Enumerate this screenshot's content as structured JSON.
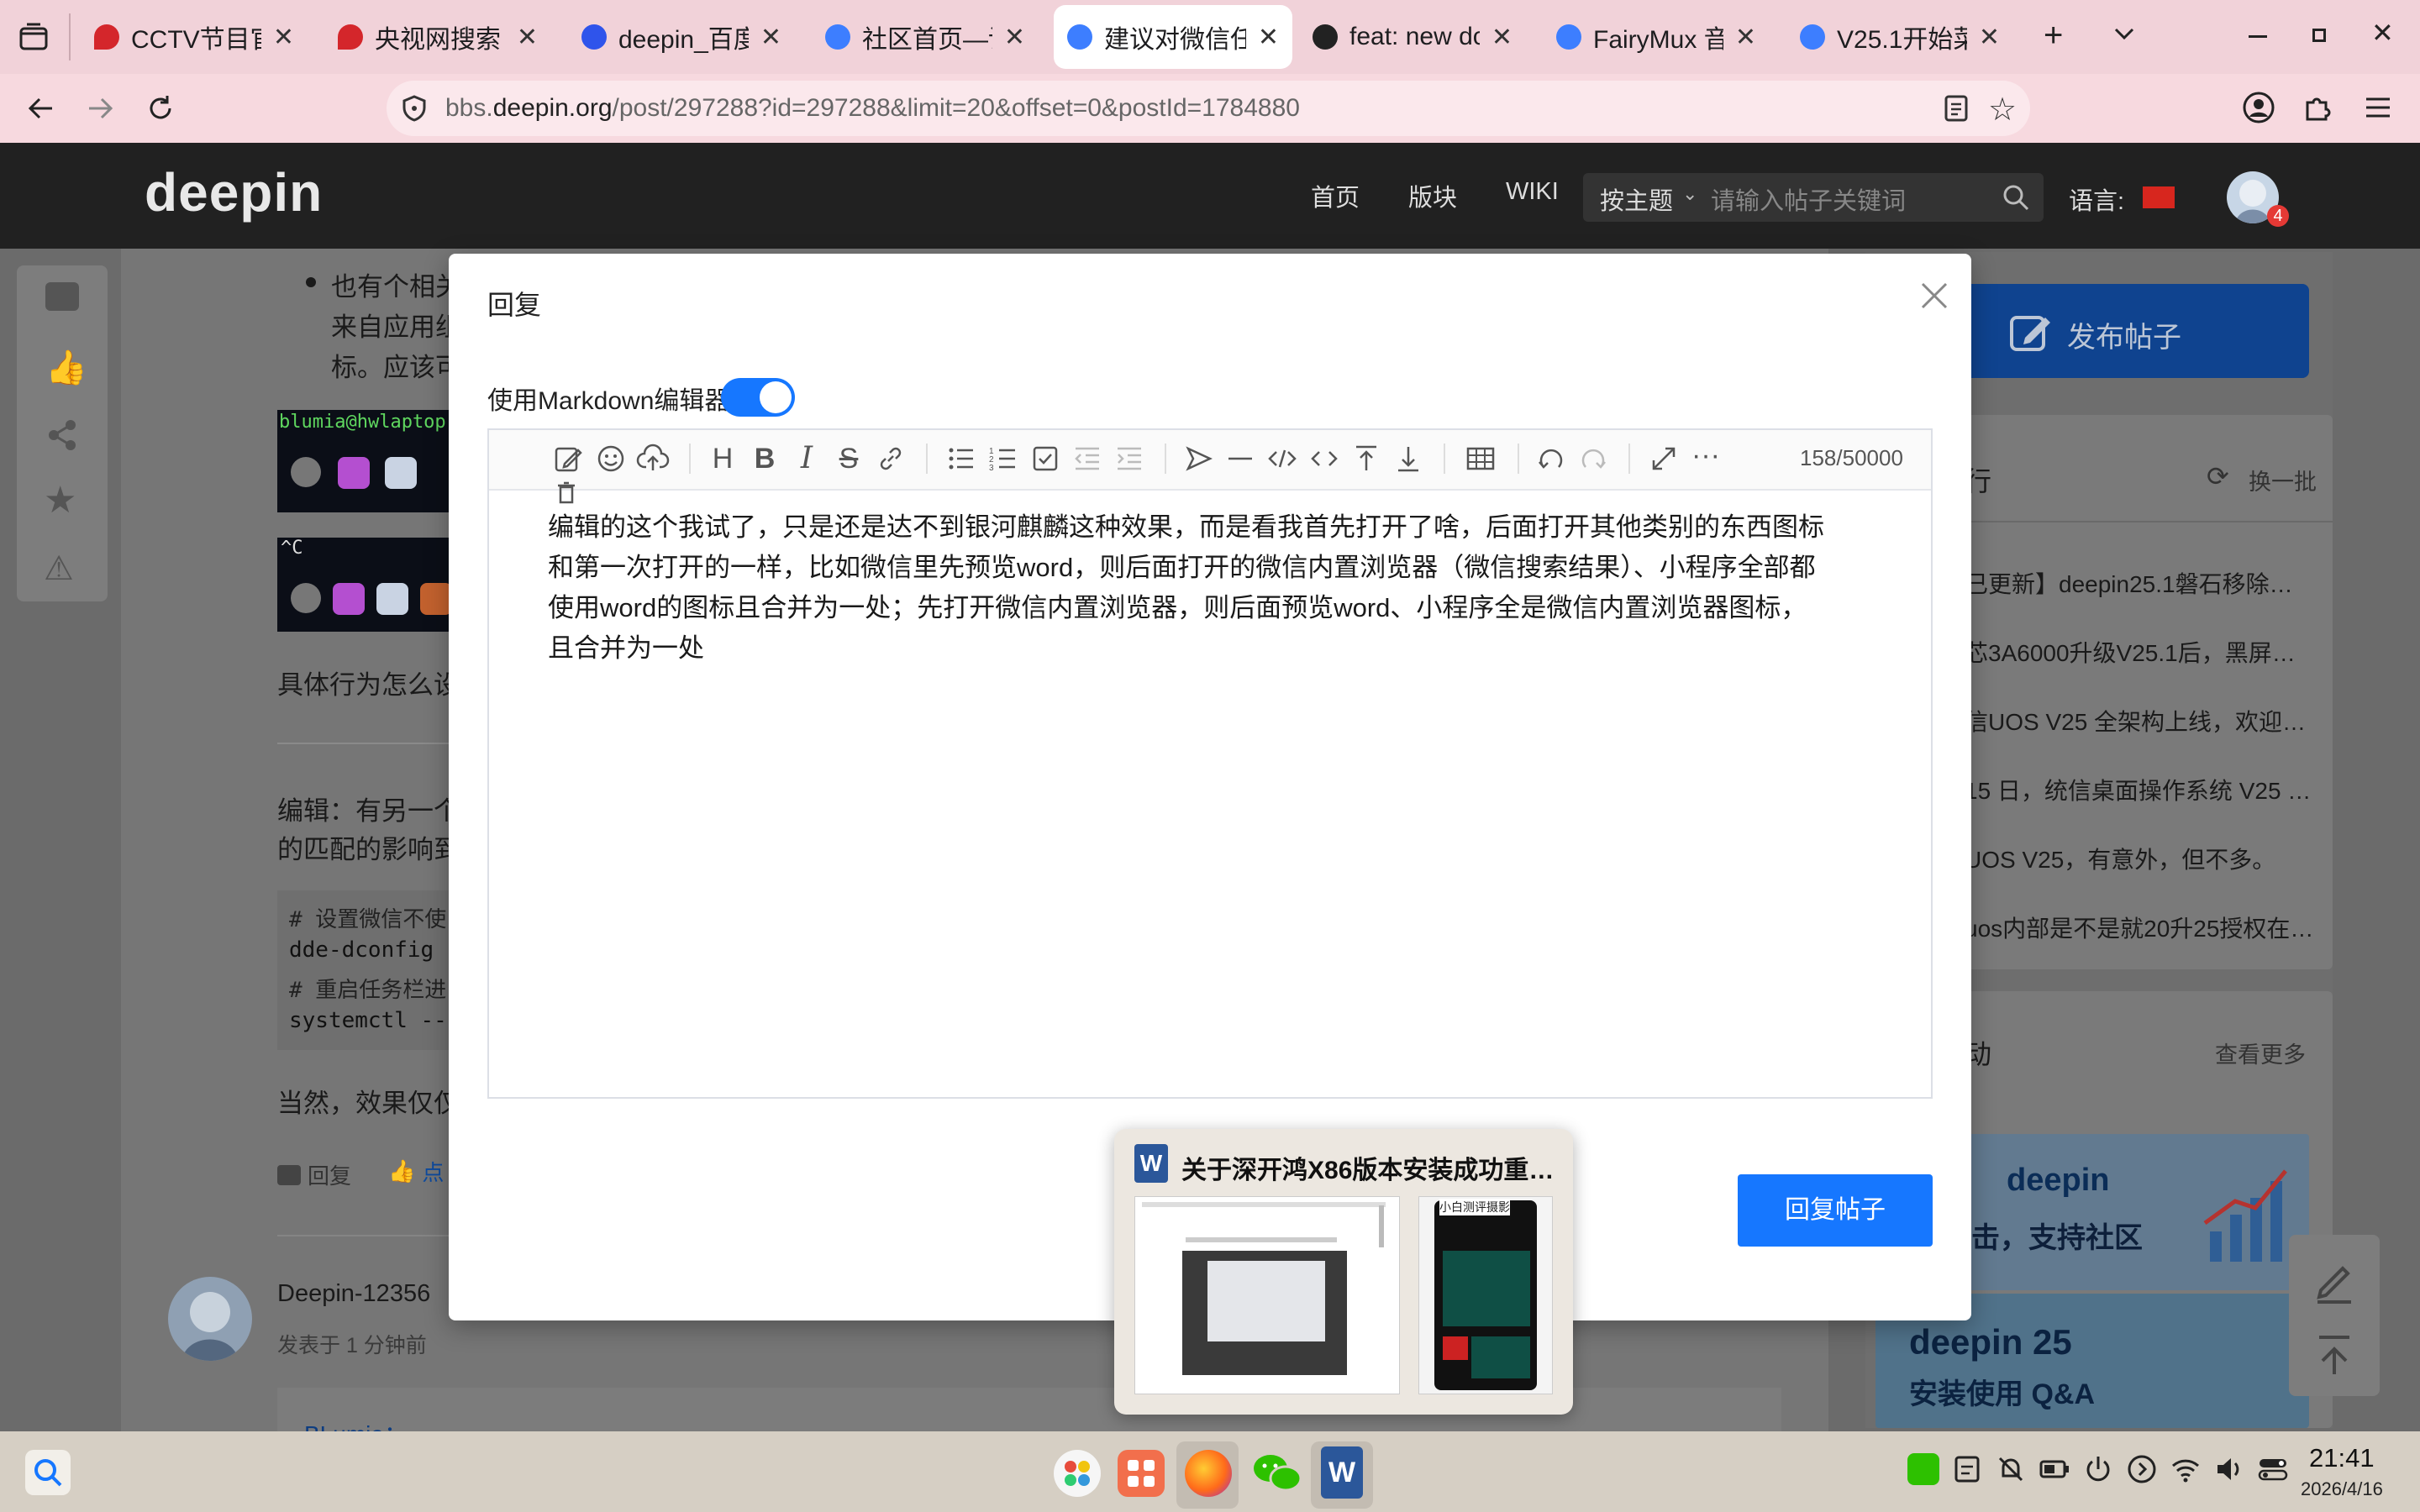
{
  "browser": {
    "tabs": [
      {
        "title": "CCTV节目官网",
        "color": "#d4262b"
      },
      {
        "title": "央视网搜索",
        "color": "#d4262b"
      },
      {
        "title": "deepin_百度",
        "color": "#2f54eb"
      },
      {
        "title": "社区首页—论",
        "color": "#3d7eff"
      },
      {
        "title": "建议对微信任",
        "color": "#3d7eff"
      },
      {
        "title": "feat: new dc",
        "color": "#222222"
      },
      {
        "title": "FairyMux 音",
        "color": "#3d7eff"
      },
      {
        "title": "V25.1开始菜",
        "color": "#3d7eff"
      }
    ],
    "url_prefix": "bbs.",
    "url_domain": "deepin.org",
    "url_path": "/post/297288?id=297288&limit=20&offset=0&postId=1784880"
  },
  "site": {
    "logo": "deepin",
    "nav": [
      "首页",
      "版块",
      "WIKI"
    ],
    "search_type": "按主题",
    "search_placeholder": "请输入帖子关键词",
    "language_label": "语言:",
    "notification_count": "4"
  },
  "post": {
    "bullet_line1": "也有个相关",
    "bullet_line2": "来自应用组",
    "bullet_line3": "标。应该可",
    "terminal_user": "blumia@hwlaptop",
    "terminal_line2": "^C",
    "para1": "具体行为怎么设",
    "edit_line1": "编辑：有另一个",
    "edit_line2": "的匹配的影响到",
    "code": [
      "# 设置微信不使",
      "dde-dconfig ",
      "# 重启任务栏进",
      "systemctl --"
    ],
    "para2": "当然，效果仅仅",
    "reply_action": "回复",
    "like_action": "点",
    "author": "Deepin-12356",
    "posted_time": "发表于 1 分钟前",
    "quote_name": "BLumia："
  },
  "sidebar_right": {
    "publish_label": "发布帖子",
    "hot_title": "行",
    "refresh_label": "换一批",
    "hot_items": [
      "已更新】deepin25.1磐石移除…",
      "芯3A6000升级V25.1后，黑屏…",
      "信UOS V25 全架构上线，欢迎…",
      "15 日，统信桌面操作系统 V25 …",
      "UOS V25，有意外，但不多。",
      "uos内部是不是就20升25授权在…"
    ],
    "activity_title": "动",
    "more_label": "查看更多",
    "banner1_brand": "deepin",
    "banner1_text": "点击，支持社区",
    "banner2_title": "deepin 25",
    "banner2_sub": "安装使用 Q&A"
  },
  "modal": {
    "title": "回复",
    "markdown_label": "使用Markdown编辑器",
    "markdown_enabled": true,
    "char_count": "158/50000",
    "content_lines": [
      "编辑的这个我试了，只是还是达不到银河麒麟这种效果，而是看我首先打开了啥，后面打开其他类别的东西图标",
      "和第一次打开的一样，比如微信里先预览word，则后面打开的微信内置浏览器（微信搜索结果）、小程序全部都",
      "使用word的图标且合并为一处；先打开微信内置浏览器，则后面预览word、小程序全是微信内置浏览器图标，",
      "且合并为一处"
    ],
    "submit_label": "回复帖子"
  },
  "preview": {
    "title": "关于深开鸿X86版本安装成功重…",
    "phone_text": "小白测评摄影"
  },
  "taskbar": {
    "time": "21:41",
    "date": "2026/4/16"
  },
  "colors": {
    "accent": "#1677ff",
    "header": "#212121",
    "tabbar": "#f1d2d9"
  }
}
